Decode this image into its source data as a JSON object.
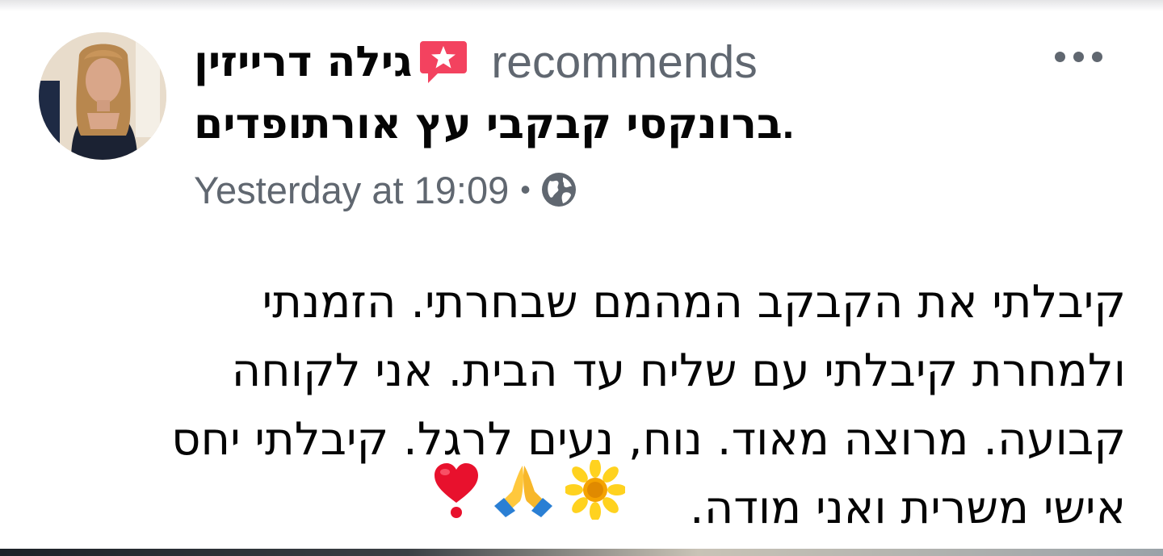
{
  "post": {
    "author": "גילה דרייזין",
    "action_text": "recommends",
    "page_name": "ברונקסי קבקבי עץ אורתופדים",
    "page_suffix": ".",
    "timestamp": "Yesterday at 19:09",
    "separator": "•",
    "privacy_icon": "globe-icon",
    "recommendation_icon": "star-speech-bubble-icon",
    "more_icon": "more-options-icon",
    "body": "קיבלתי את הקבקב המהמם שבחרתי. הזמנתי\nולמחרת קיבלתי עם שליח עד הבית. אני לקוחה\nקבועה. מרוצה מאוד. נוח, נעים לרגל. קיבלתי יחס\nאישי משרית ואני מודה.",
    "emojis": [
      "sunflower-emoji",
      "folded-hands-emoji",
      "heart-exclamation-emoji"
    ]
  },
  "colors": {
    "name": "#050505",
    "secondary": "#606770",
    "recommend_icon": "#f3425f"
  }
}
